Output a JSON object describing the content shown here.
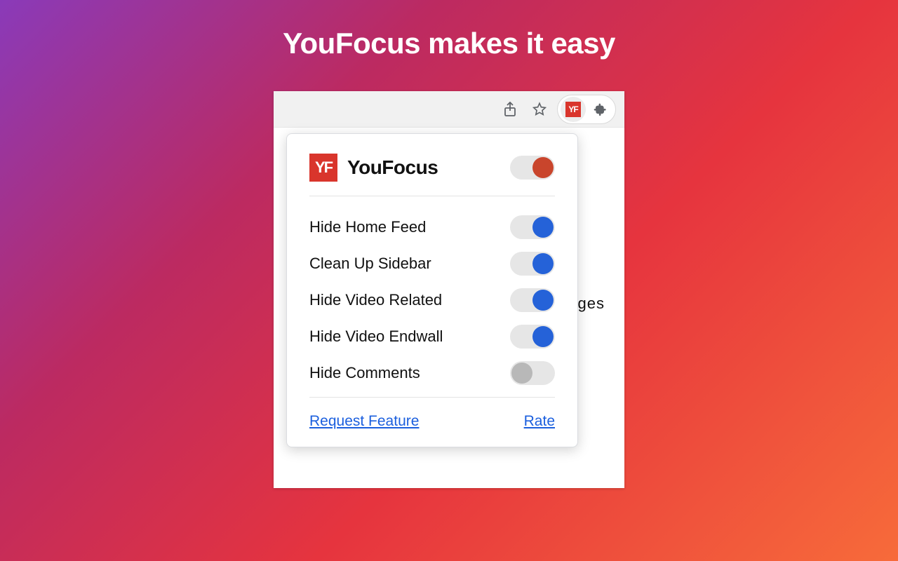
{
  "hero": {
    "title": "YouFocus makes it easy"
  },
  "background_fragment": "ges",
  "popup": {
    "title": "YouFocus",
    "master_enabled": true,
    "options": [
      {
        "label": "Hide Home Feed",
        "enabled": true
      },
      {
        "label": "Clean Up Sidebar",
        "enabled": true
      },
      {
        "label": "Hide Video Related",
        "enabled": true
      },
      {
        "label": "Hide Video Endwall",
        "enabled": true
      },
      {
        "label": "Hide Comments",
        "enabled": false
      }
    ],
    "footer": {
      "request_feature": "Request Feature",
      "rate": "Rate"
    }
  }
}
